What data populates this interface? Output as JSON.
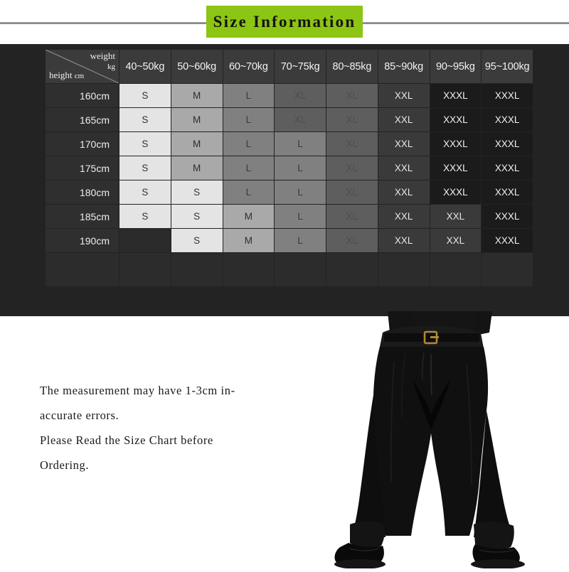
{
  "banner": {
    "title": "Size Information",
    "chip_color": "#8cc513"
  },
  "table": {
    "corner": {
      "weight_label": "weight",
      "weight_unit": "kg",
      "height_label": "height",
      "height_unit": "cm"
    },
    "column_headers": [
      "40~50kg",
      "50~60kg",
      "60~70kg",
      "70~75kg",
      "80~85kg",
      "85~90kg",
      "90~95kg",
      "95~100kg"
    ],
    "row_headers": [
      "160cm",
      "165cm",
      "170cm",
      "175cm",
      "180cm",
      "185cm",
      "190cm"
    ],
    "rows": [
      [
        "S",
        "M",
        "L",
        "XL",
        "XL",
        "XXL",
        "XXXL",
        "XXXL"
      ],
      [
        "S",
        "M",
        "L",
        "XL",
        "XL",
        "XXL",
        "XXXL",
        "XXXL"
      ],
      [
        "S",
        "M",
        "L",
        "L",
        "XL",
        "XXL",
        "XXXL",
        "XXXL"
      ],
      [
        "S",
        "M",
        "L",
        "L",
        "XL",
        "XXL",
        "XXXL",
        "XXXL"
      ],
      [
        "S",
        "S",
        "L",
        "L",
        "XL",
        "XXL",
        "XXXL",
        "XXXL"
      ],
      [
        "S",
        "S",
        "M",
        "L",
        "XL",
        "XXL",
        "XXL",
        "XXXL"
      ],
      [
        "",
        "S",
        "M",
        "L",
        "XL",
        "XXL",
        "XXL",
        "XXXL"
      ]
    ]
  },
  "notes": {
    "lines": [
      "The measurement may have 1-3cm in-",
      "accurate errors.",
      "Please Read the Size Chart before",
      "Ordering."
    ]
  },
  "model": {
    "alt": "man-wearing-black-trousers"
  }
}
